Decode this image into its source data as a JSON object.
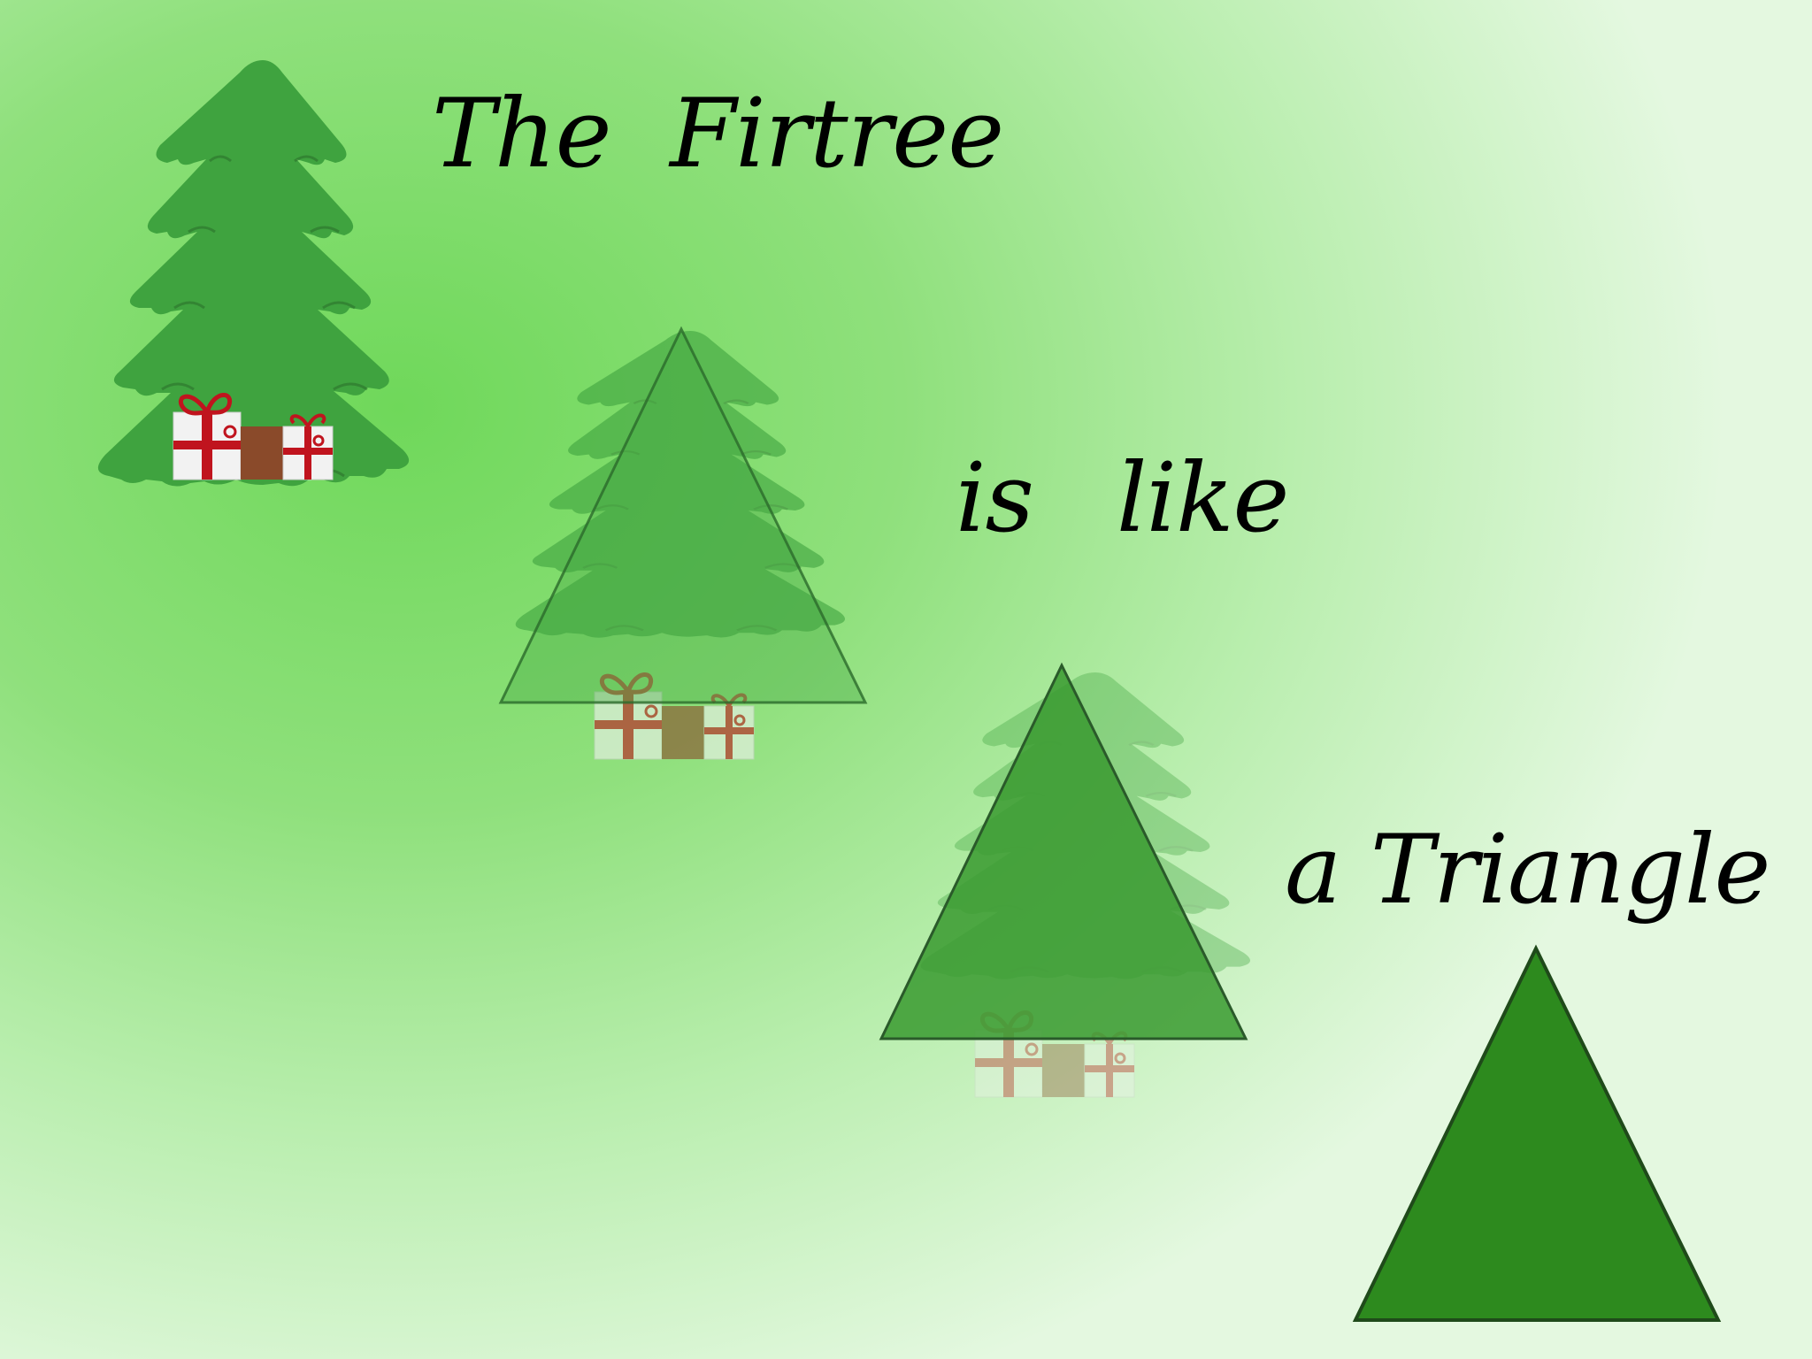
{
  "slide": {
    "captions": {
      "line1": "The  Firtree",
      "line2_is": "is",
      "line2_like": "like",
      "line3": "a Triangle"
    }
  },
  "colors": {
    "tree_green": "#3fa33f",
    "tree_outline": "#2a7a2a",
    "triangle_green": "#2d8a1e",
    "ribbon_red": "#c0141e",
    "box_white": "#f2f2f2",
    "box_brown": "#8a4a2a"
  }
}
